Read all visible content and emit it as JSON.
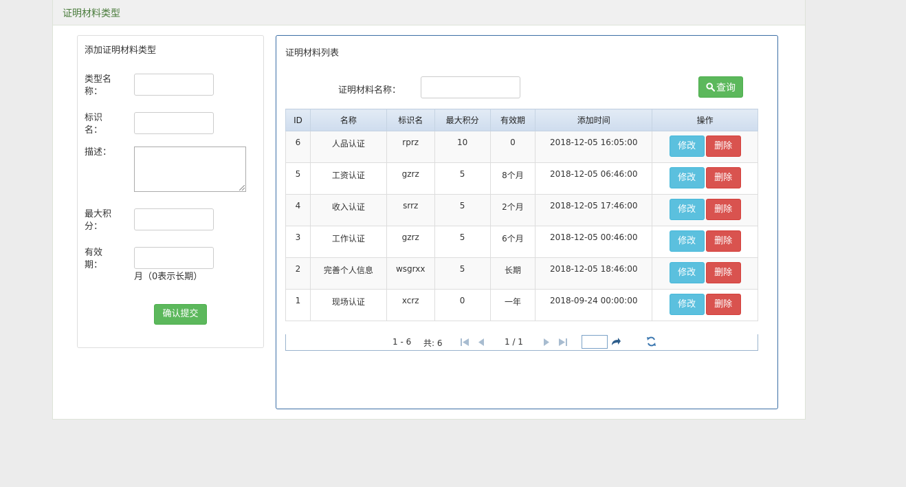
{
  "page": {
    "header_title": "证明材料类型"
  },
  "form": {
    "title": "添加证明材料类型",
    "type_name_label": "类型名称：",
    "identifier_label": "标识名：",
    "description_label": "描述：",
    "max_points_label": "最大积分：",
    "validity_label": "有效期：",
    "validity_hint": "月（0表示长期）",
    "submit_label": "确认提交"
  },
  "list": {
    "title": "证明材料列表",
    "search_label": "证明材料名称：",
    "query_label": "查询",
    "columns": [
      "ID",
      "名称",
      "标识名",
      "最大积分",
      "有效期",
      "添加时间",
      "操作"
    ],
    "edit_label": "修改",
    "delete_label": "删除",
    "rows": [
      {
        "id": "6",
        "name": "人品认证",
        "code": "rprz",
        "max_points": "10",
        "validity": "0",
        "added": "2018-12-05 16:05:00"
      },
      {
        "id": "5",
        "name": "工资认证",
        "code": "gzrz",
        "max_points": "5",
        "validity": "8个月",
        "added": "2018-12-05 06:46:00"
      },
      {
        "id": "4",
        "name": "收入认证",
        "code": "srrz",
        "max_points": "5",
        "validity": "2个月",
        "added": "2018-12-05 17:46:00"
      },
      {
        "id": "3",
        "name": "工作认证",
        "code": "gzrz",
        "max_points": "5",
        "validity": "6个月",
        "added": "2018-12-05 00:46:00"
      },
      {
        "id": "2",
        "name": "完善个人信息",
        "code": "wsgrxx",
        "max_points": "5",
        "validity": "长期",
        "added": "2018-12-05 18:46:00"
      },
      {
        "id": "1",
        "name": "现场认证",
        "code": "xcrz",
        "max_points": "0",
        "validity": "一年",
        "added": "2018-09-24 00:00:00"
      }
    ]
  },
  "pager": {
    "range": "1 - 6",
    "total": "共: 6",
    "page_info": "1 / 1"
  },
  "colors": {
    "green": "#5cb85c",
    "info": "#5bc0de",
    "danger": "#d9534f",
    "panel_border": "#3b6ea5"
  }
}
